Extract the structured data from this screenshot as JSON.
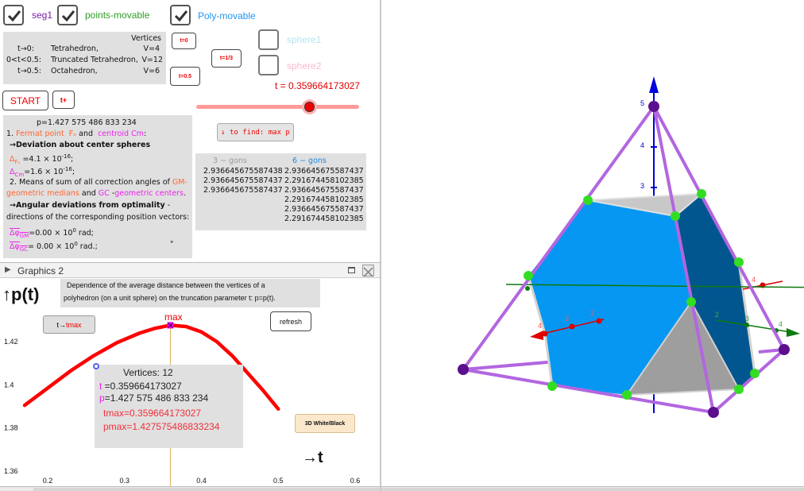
{
  "top_checkboxes": [
    {
      "label": "seg1",
      "checked": true,
      "color": "#7a1fa2"
    },
    {
      "label": "points-movable",
      "checked": true,
      "color": "#2e9e24"
    },
    {
      "label": "Poly-movable",
      "checked": true,
      "color": "#2196f3"
    }
  ],
  "sphere_checkboxes": [
    {
      "label": "sphere1",
      "checked": false,
      "color": "#b3e5ec"
    },
    {
      "label": "sphere2",
      "checked": false,
      "color": "#f8bbd0"
    }
  ],
  "vertices_box": {
    "header": "Vertices",
    "rows": [
      {
        "cond": "t→0:",
        "name": "Tetrahedron,",
        "v": "V=4"
      },
      {
        "cond": "0<t<0.5:",
        "name": "Truncated Tetrahedron,",
        "v": "V=12"
      },
      {
        "cond": "t→0.5:",
        "name": "Octahedron,",
        "v": "V=6"
      }
    ]
  },
  "buttons": {
    "t0": "t=0",
    "t13": "t=1/3",
    "t05": "t=0.5",
    "start": "START",
    "tplus": "t+",
    "find_max": "↓ to find: max  p",
    "t_tmax_prefix": "t→",
    "t_tmax_suffix": "tmax",
    "refresh": "refresh",
    "white_black": "3D White/Black"
  },
  "slider": {
    "label": "t = 0.359664173027",
    "value": 0.359664173027,
    "min": 0,
    "max": 0.5,
    "color": "#e00000"
  },
  "info_box": {
    "p_line": "p=1.427 575 486 833 234",
    "l1_num": "1. ",
    "l1_fermat": "Fermat point",
    "l1_fo": "Fₒ",
    "l1_and": " and ",
    "l1_centroid": "centroid Cm",
    "l1_colon": ":",
    "l2": "→Deviation about center spheres",
    "delta_fo_sym": "Δ",
    "delta_fo_sub": "Fₒ",
    "delta_fo_val": "=4.1 × 10",
    "delta_fo_exp": "-16",
    "delta_cm_sym": "Δ",
    "delta_cm_sub": "Cm",
    "delta_cm_val": "=1.6 × 10",
    "delta_cm_exp": "-16",
    "l5": "2. Means of sum of all correction angles of ",
    "l5_gm": "GM-",
    "l6_gmed": "geometric medians",
    "l6_and": " and ",
    "l6_gc": "GC",
    "l6_dash": " -",
    "l6_gcent": "geometric centers",
    "l6_dot": ".",
    "l7": "→Angular deviations from optimality",
    "l7_dash": " -",
    "l8": "directions of the corresponding position vectors:",
    "phi_gm_sym": "Δφ",
    "phi_gm_sub": "GM",
    "phi_gm_val": "=0.00 × 10",
    "phi_gm_exp": "0",
    "phi_gm_unit": " rad;",
    "phi_gc_sym": "Δφ",
    "phi_gc_sub": "GC",
    "phi_gc_val": "= 0.00 × 10",
    "phi_gc_exp": "0",
    "phi_gc_unit": " rad.;",
    "quote": "\""
  },
  "gons_table": {
    "col1_header": "3 − gons",
    "col2_header": "6 − gons",
    "col1": [
      "2.936645675587438",
      "2.936645675587437",
      "2.936645675587437"
    ],
    "col2": [
      "2.936645675587437",
      "2.291674458102385",
      "2.936645675587437",
      "2.291674458102385",
      "2.936645675587437",
      "2.291674458102385"
    ]
  },
  "graphics2": {
    "title": "Graphics 2",
    "ylabel": "↑p(t)",
    "xlabel": "→t",
    "description_line1": "Dependence of the average distance between the vertices of a",
    "description_line2": "polyhedron (on a unit sphere) on the truncation parameter t: p=p(t).",
    "max_label": "max",
    "info": {
      "vertices": "Vertices: 12",
      "t_sym": "t",
      "t_val": " =0.359664173027",
      "p_sym": "p",
      "p_val": "=1.427 575 486 833 234",
      "tmax": "tmax=0.359664173027",
      "pmax": "pmax=1.427575486833234"
    }
  },
  "chart_data": {
    "type": "line",
    "title": "p(t)",
    "xlabel": "→t",
    "ylabel": "↑p(t)",
    "xlim": [
      0.15,
      0.62
    ],
    "ylim": [
      1.355,
      1.435
    ],
    "x_ticks": [
      "0.2",
      "0.3",
      "0.4",
      "0.5",
      "0.6"
    ],
    "y_ticks": [
      "1.42",
      "1.4",
      "1.38",
      "1.36"
    ],
    "series": [
      {
        "name": "p(t)",
        "color": "#ff0000",
        "x": [
          0.17,
          0.2,
          0.23,
          0.26,
          0.29,
          0.32,
          0.34,
          0.36,
          0.38,
          0.4,
          0.42,
          0.44,
          0.46,
          0.48,
          0.5
        ],
        "y": [
          1.3905,
          1.3985,
          1.4065,
          1.4135,
          1.4195,
          1.424,
          1.4262,
          1.4276,
          1.427,
          1.4245,
          1.42,
          1.4135,
          1.4055,
          1.3975,
          1.3888
        ]
      }
    ],
    "markers": [
      {
        "name": "max",
        "x": 0.359664173027,
        "y": 1.427575486833234,
        "color": "#ff00ff"
      }
    ],
    "vertical_line_x": 0.359664173027,
    "grid": false
  },
  "view3d": {
    "z_ticks": [
      "5",
      "4",
      "3"
    ],
    "x_ticks": [
      "4",
      "3",
      "2"
    ],
    "y_ticks": [
      "2",
      "3",
      "4"
    ],
    "x_ticks_far": [
      "4"
    ],
    "colors": {
      "face_light": "#0597f2",
      "face_dark": "#02568f",
      "face_gray": "#9e9e9e",
      "edge": "#b266e0",
      "point_green": "#33dd22",
      "point_purple": "#5c0f8c",
      "axis_z": "#0000dd",
      "axis_x": "#dd0000",
      "axis_y": "#0c7a0c"
    }
  }
}
